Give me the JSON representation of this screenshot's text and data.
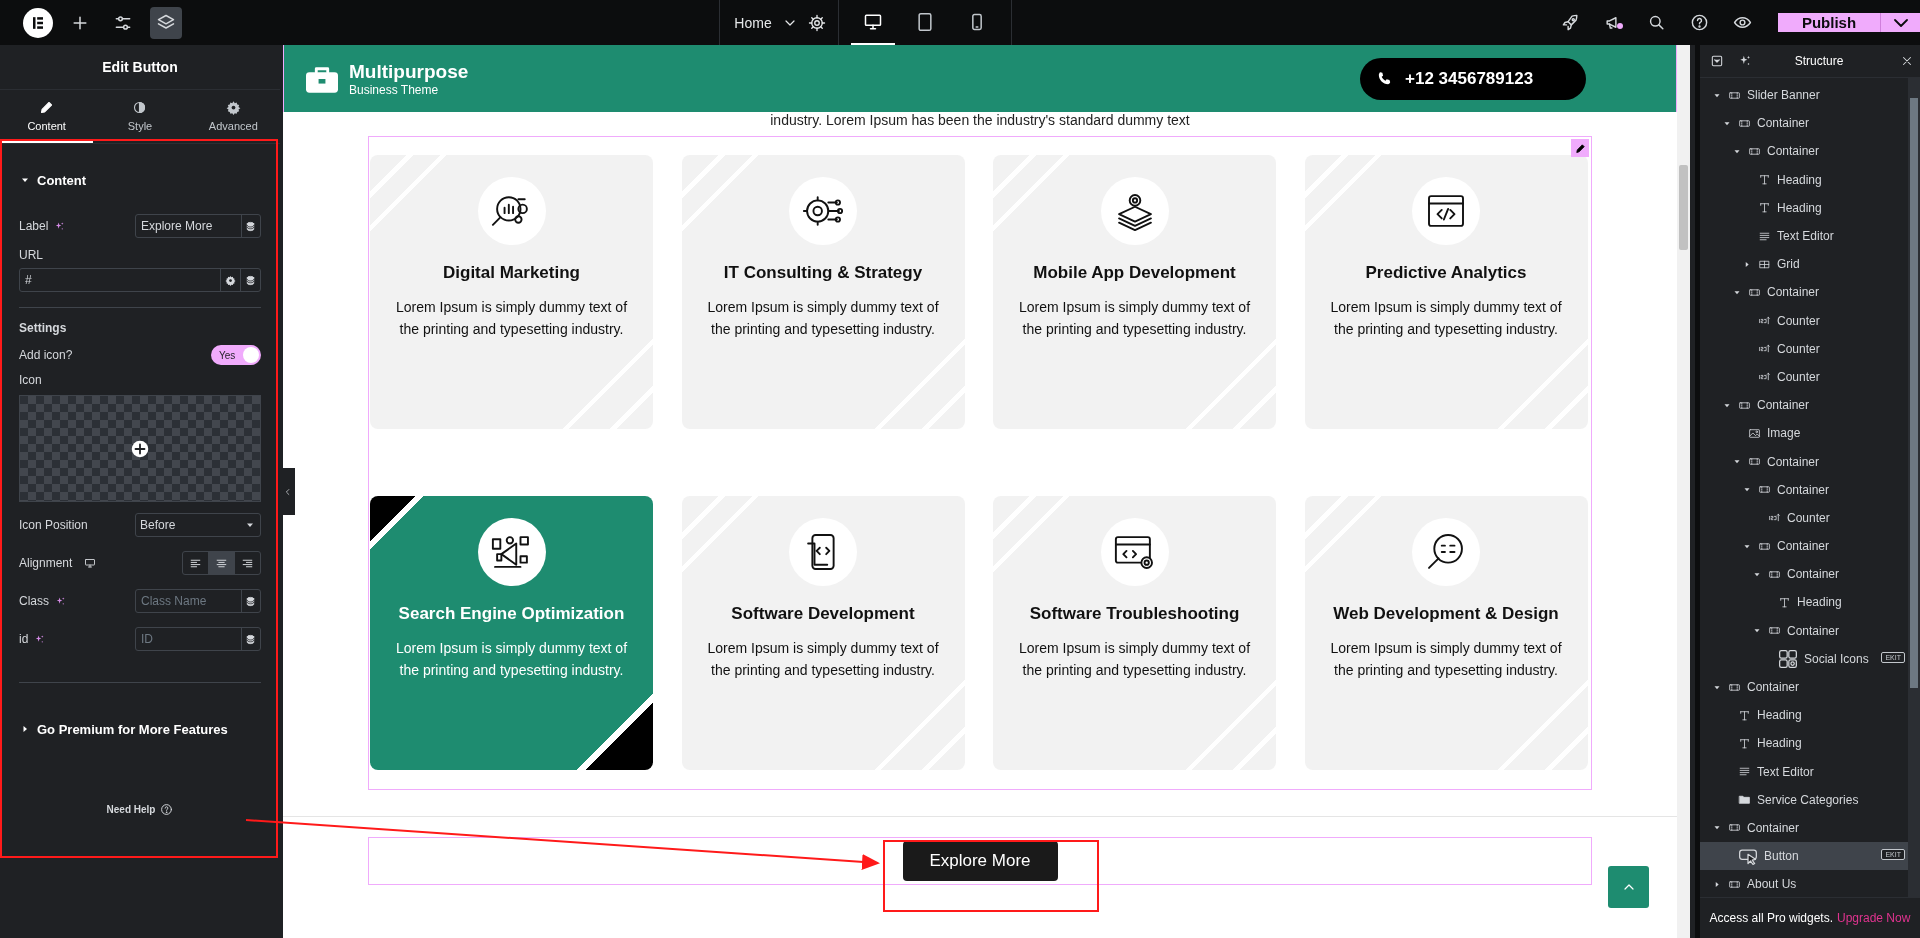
{
  "topbar": {
    "tools": [
      {
        "kind": "logo",
        "selected": false
      },
      {
        "kind": "add",
        "selected": false
      },
      {
        "kind": "settings",
        "selected": false
      },
      {
        "kind": "structure",
        "selected": true
      }
    ],
    "page": "Home",
    "devices": [
      {
        "kind": "desktop",
        "selected": true
      },
      {
        "kind": "tablet",
        "selected": false
      },
      {
        "kind": "mobile",
        "selected": false
      }
    ],
    "actions": [
      {
        "kind": "launch",
        "unread": false
      },
      {
        "kind": "whats-new",
        "unread": true
      },
      {
        "kind": "search",
        "unread": false
      },
      {
        "kind": "help",
        "unread": false
      },
      {
        "kind": "preview",
        "unread": false
      }
    ],
    "publish": "Publish"
  },
  "editor": {
    "title": "Edit Button",
    "tabs": [
      {
        "label": "Content",
        "kind": "content",
        "selected": true
      },
      {
        "label": "Style",
        "kind": "style",
        "selected": false
      },
      {
        "label": "Advanced",
        "kind": "advanced",
        "selected": false
      }
    ],
    "content_section": {
      "title": "Content",
      "expanded": true
    },
    "label_field": {
      "label": "Label",
      "value": "Explore More"
    },
    "url_field": {
      "label": "URL",
      "value": "#"
    },
    "settings_heading": "Settings",
    "add_icon": {
      "label": "Add icon?",
      "on": true,
      "state_label": "Yes"
    },
    "icon_picker": {
      "label": "Icon"
    },
    "icon_position": {
      "label": "Icon Position",
      "value": "Before"
    },
    "alignment": {
      "label": "Alignment",
      "options": [
        {
          "kind": "left",
          "selected": false
        },
        {
          "kind": "center",
          "selected": true
        },
        {
          "kind": "right",
          "selected": false
        }
      ]
    },
    "class_field": {
      "label": "Class",
      "placeholder": "Class Name"
    },
    "id_field": {
      "label": "id",
      "placeholder": "ID"
    },
    "premium_section": {
      "title": "Go Premium for More Features",
      "expanded": false
    },
    "help": "Need Help"
  },
  "canvas": {
    "header": {
      "brand": "Multipurpose",
      "tagline": "Business Theme",
      "phone": "+12 3456789123"
    },
    "intro": "industry. Lorem Ipsum has been the industry's standard dummy text",
    "cards": [
      {
        "kind": "marketing",
        "title": "Digital Marketing",
        "text": "Lorem Ipsum is simply dummy text of the printing and typesetting industry.",
        "highlighted": false
      },
      {
        "kind": "consulting",
        "title": "IT Consulting & Strategy",
        "text": "Lorem Ipsum is simply dummy text of the printing and typesetting industry.",
        "highlighted": false
      },
      {
        "kind": "layers",
        "title": "Mobile App Development",
        "text": "Lorem Ipsum is simply dummy text of the printing and typesetting industry.",
        "highlighted": false
      },
      {
        "kind": "code-window",
        "title": "Predictive Analytics",
        "text": "Lorem Ipsum is simply dummy text of the printing and typesetting industry.",
        "highlighted": false
      },
      {
        "kind": "megaphone",
        "title": "Search Engine Optimization",
        "text": "Lorem Ipsum is simply dummy text of the printing and typesetting industry.",
        "highlighted": true
      },
      {
        "kind": "phone-code",
        "title": "Software Development",
        "text": "Lorem Ipsum is simply dummy text of the printing and typesetting industry.",
        "highlighted": false
      },
      {
        "kind": "browser-gear",
        "title": "Software Troubleshooting",
        "text": "Lorem Ipsum is simply dummy text of the printing and typesetting industry.",
        "highlighted": false
      },
      {
        "kind": "magnifier",
        "title": "Web Development & Design",
        "text": "Lorem Ipsum is simply dummy text of the printing and typesetting industry.",
        "highlighted": false
      }
    ],
    "button": "Explore More"
  },
  "structure": {
    "title": "Structure",
    "tree": [
      {
        "label": "Slider Banner",
        "kind": "container",
        "expanded": true,
        "selected": false,
        "children": [
          {
            "label": "Container",
            "kind": "container",
            "expanded": true,
            "selected": false,
            "children": [
              {
                "label": "Container",
                "kind": "container",
                "expanded": true,
                "selected": false,
                "children": [
                  {
                    "label": "Heading",
                    "kind": "heading",
                    "selected": false
                  },
                  {
                    "label": "Heading",
                    "kind": "heading",
                    "selected": false
                  },
                  {
                    "label": "Text Editor",
                    "kind": "text-editor",
                    "selected": false
                  },
                  {
                    "label": "Grid",
                    "kind": "grid",
                    "expanded": false,
                    "selected": false
                  }
                ]
              },
              {
                "label": "Container",
                "kind": "container",
                "expanded": true,
                "selected": false,
                "children": [
                  {
                    "label": "Counter",
                    "kind": "counter",
                    "selected": false
                  },
                  {
                    "label": "Counter",
                    "kind": "counter",
                    "selected": false
                  },
                  {
                    "label": "Counter",
                    "kind": "counter",
                    "selected": false
                  }
                ]
              }
            ]
          },
          {
            "label": "Container",
            "kind": "container",
            "expanded": true,
            "selected": false,
            "children": [
              {
                "label": "Image",
                "kind": "image",
                "selected": false
              },
              {
                "label": "Container",
                "kind": "container",
                "expanded": true,
                "selected": false,
                "children": [
                  {
                    "label": "Container",
                    "kind": "container",
                    "expanded": true,
                    "selected": false,
                    "children": [
                      {
                        "label": "Counter",
                        "kind": "counter",
                        "selected": false
                      }
                    ]
                  },
                  {
                    "label": "Container",
                    "kind": "container",
                    "expanded": true,
                    "selected": false,
                    "children": [
                      {
                        "label": "Container",
                        "kind": "container",
                        "expanded": true,
                        "selected": false,
                        "children": [
                          {
                            "label": "Heading",
                            "kind": "heading",
                            "selected": false
                          }
                        ]
                      },
                      {
                        "label": "Container",
                        "kind": "container",
                        "expanded": true,
                        "selected": false,
                        "children": [
                          {
                            "label": "Social Icons",
                            "kind": "social",
                            "selected": false,
                            "badge": "EKIT"
                          }
                        ]
                      }
                    ]
                  }
                ]
              }
            ]
          }
        ]
      },
      {
        "label": "Container",
        "kind": "container",
        "expanded": true,
        "selected": false,
        "children": [
          {
            "label": "Heading",
            "kind": "heading",
            "selected": false
          },
          {
            "label": "Heading",
            "kind": "heading",
            "selected": false
          },
          {
            "label": "Text Editor",
            "kind": "text-editor",
            "selected": false
          },
          {
            "label": "Service Categories",
            "kind": "folder",
            "selected": false
          }
        ]
      },
      {
        "label": "Container",
        "kind": "container",
        "expanded": true,
        "selected": false,
        "children": [
          {
            "label": "Button",
            "kind": "button",
            "selected": true,
            "badge": "EKIT"
          }
        ]
      },
      {
        "label": "About Us",
        "kind": "container",
        "expanded": false,
        "selected": false
      }
    ],
    "footer": {
      "text": "Access all Pro widgets.",
      "link": "Upgrade Now"
    }
  }
}
